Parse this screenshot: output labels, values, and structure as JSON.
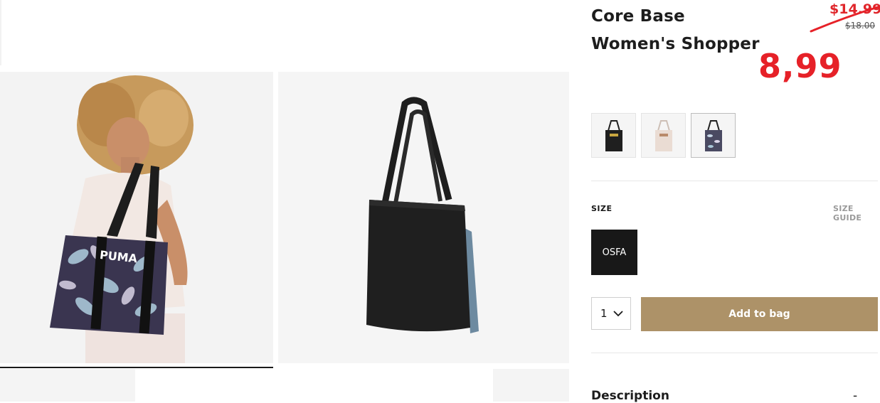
{
  "product": {
    "title_line1": "Core Base",
    "title_line2": "Women's Shopper",
    "old_price": "$14.99",
    "original_price": "$18.00",
    "sale_price": "8,99"
  },
  "swatches": [
    {
      "name": "Black",
      "selected": false
    },
    {
      "name": "Cream",
      "selected": false
    },
    {
      "name": "Floral Print",
      "selected": true
    }
  ],
  "size": {
    "label": "SIZE",
    "guide_label": "SIZE GUIDE",
    "options": [
      "OSFA"
    ]
  },
  "quantity": {
    "value": "1"
  },
  "add_to_bag_label": "Add to bag",
  "description": {
    "label": "Description",
    "toggle": "-"
  },
  "colors": {
    "sale_red": "#e62128",
    "add_button": "#ad9268",
    "size_selected": "#181818"
  }
}
